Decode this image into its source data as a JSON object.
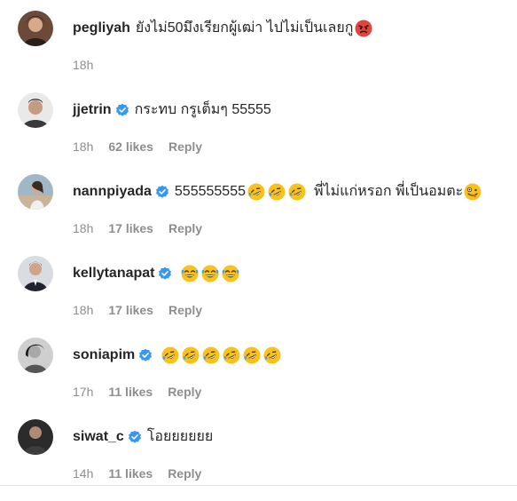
{
  "comments": [
    {
      "username": "pegliyah",
      "verified": false,
      "text": "ยังไม่50มึงเรียกผู้เฒ่า ไปไม่เป็นเลยกู",
      "emojis": [
        "angry-face"
      ],
      "time": "18h",
      "likes": "",
      "reply": ""
    },
    {
      "username": "jjetrin",
      "verified": true,
      "text": "กระทบ กรูเต็มๆ 55555",
      "emojis": [],
      "time": "18h",
      "likes": "62 likes",
      "reply": "Reply"
    },
    {
      "username": "nannpiyada",
      "verified": true,
      "text": "555555555",
      "emojis": [
        "rofl",
        "rofl",
        "rofl"
      ],
      "text2": "พี่ไม่แก่หรอก พี่เป็นอมตะ",
      "emojis2": [
        "zany-face"
      ],
      "time": "18h",
      "likes": "17 likes",
      "reply": "Reply"
    },
    {
      "username": "kellytanapat",
      "verified": true,
      "text": "",
      "emojis": [
        "grin-sweat",
        "grin-sweat",
        "grin-sweat"
      ],
      "time": "18h",
      "likes": "17 likes",
      "reply": "Reply"
    },
    {
      "username": "soniapim",
      "verified": true,
      "text": "",
      "emojis": [
        "rofl",
        "rofl",
        "rofl",
        "rofl",
        "rofl",
        "rofl"
      ],
      "time": "17h",
      "likes": "11 likes",
      "reply": "Reply"
    },
    {
      "username": "siwat_c",
      "verified": true,
      "text": "โอยยยยยย",
      "emojis": [],
      "time": "14h",
      "likes": "11 likes",
      "reply": "Reply"
    }
  ],
  "colors": {
    "text": "#262626",
    "meta": "#8e8e8e",
    "verified": "#3897f0",
    "emoji_yellow": "#f7c21c",
    "emoji_red": "#e0463c"
  }
}
